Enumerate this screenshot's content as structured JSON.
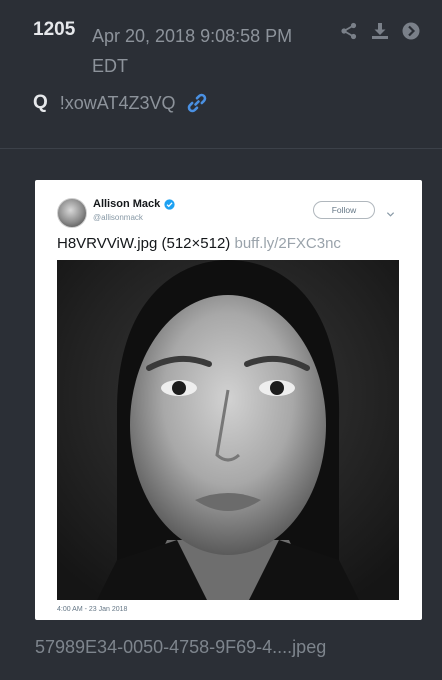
{
  "post": {
    "number": "1205",
    "date": "Apr 20, 2018 9:08:58 PM EDT",
    "poster": "Q",
    "tripcode": "!xowAT4Z3VQ",
    "filename": "57989E34-0050-4758-9F69-4....jpeg"
  },
  "tweet": {
    "name": "Allison Mack",
    "handle": "@allisonmack",
    "follow_label": "Follow",
    "text": "H8VRVViW.jpg (512×512)",
    "link": "buff.ly/2FXC3nc",
    "timestamp": "4:00 AM - 23 Jan 2018"
  },
  "icons": {
    "share": "share-icon",
    "download": "download-icon",
    "goto": "arrow-circle-icon",
    "link": "link-icon",
    "verified": "verified-badge-icon",
    "menu": "chevron-down-icon"
  },
  "colors": {
    "background": "#2b2f36",
    "link": "#4a90e2",
    "verified": "#1da1f2"
  }
}
